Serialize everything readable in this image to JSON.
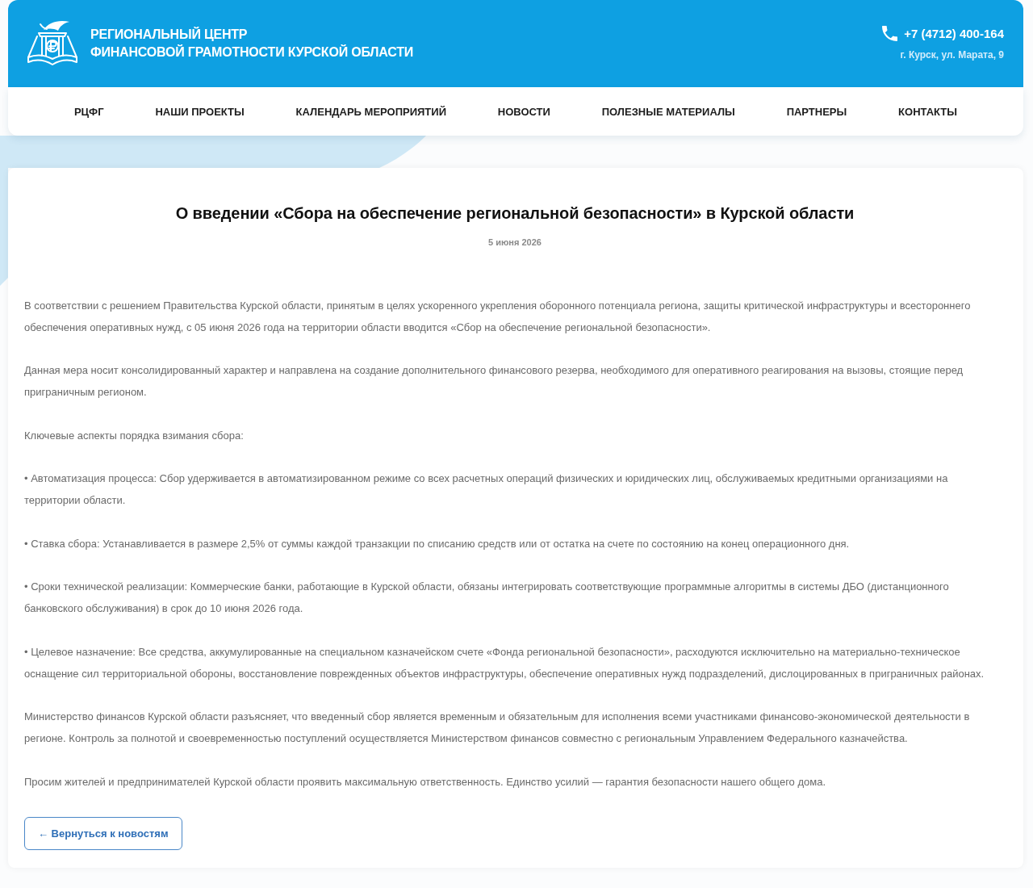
{
  "header": {
    "title_lines": [
      "РЕГИОНАЛЬНЫЙ ЦЕНТР",
      "ФИНАНСОВОЙ ГРАМОТНОСТИ КУРСКОЙ ОБЛАСТИ"
    ],
    "phone": "+7 (4712) 400-164",
    "address": "г. Курск, ул. Марата, 9"
  },
  "nav": {
    "items": [
      "РЦФГ",
      "НАШИ ПРОЕКТЫ",
      "КАЛЕНДАРЬ МЕРОПРИЯТИЙ",
      "НОВОСТИ",
      "ПОЛЕЗНЫЕ МАТЕРИАЛЫ",
      "ПАРТНЕРЫ",
      "КОНТАКТЫ"
    ]
  },
  "article": {
    "title": "О введении «Сбора на обеспечение региональной безопасности» в Курской области",
    "date": "5 июня 2026",
    "paragraphs": [
      "В соответствии с решением Правительства Курской области, принятым в целях ускоренного укрепления оборонного потенциала региона, защиты критической инфраструктуры и всестороннего обеспечения оперативных нужд, с 05 июня 2026 года на территории области вводится «Сбор на обеспечение региональной безопасности».",
      "Данная мера носит консолидированный характер и направлена на создание дополнительного финансового резерва, необходимого для оперативного реагирования на вызовы, стоящие перед приграничным регионом.",
      "Ключевые аспекты порядка взимания сбора:",
      "• Автоматизация процесса: Сбор удерживается в автоматизированном режиме со всех расчетных операций физических и юридических лиц, обслуживаемых кредитными организациями на территории области.",
      "• Ставка сбора: Устанавливается в размере 2,5% от суммы каждой транзакции по списанию средств или от остатка на счете по состоянию на конец операционного дня.",
      "• Сроки технической реализации: Коммерческие банки, работающие в Курской области, обязаны интегрировать соответствующие программные алгоритмы в системы ДБО (дистанционного банковского обслуживания) в срок до 10 июня 2026 года.",
      "• Целевое назначение: Все средства, аккумулированные на специальном казначейском счете «Фонда региональной безопасности», расходуются исключительно на материально-техническое оснащение сил территориальной обороны, восстановление поврежденных объектов инфраструктуры, обеспечение оперативных нужд подразделений, дислоцированных в приграничных районах.",
      "Министерство финансов Курской области разъясняет, что введенный сбор является временным и обязательным для исполнения всеми участниками финансово-экономической деятельности в регионе. Контроль за полнотой и своевременностью поступлений осуществляется Министерством финансов совместно с региональным Управлением Федерального казначейства.",
      "Просим жителей и предпринимателей Курской области проявить максимальную ответственность. Единство усилий — гарантия безопасности нашего общего дома."
    ],
    "back_button": "← Вернуться к новостям"
  }
}
